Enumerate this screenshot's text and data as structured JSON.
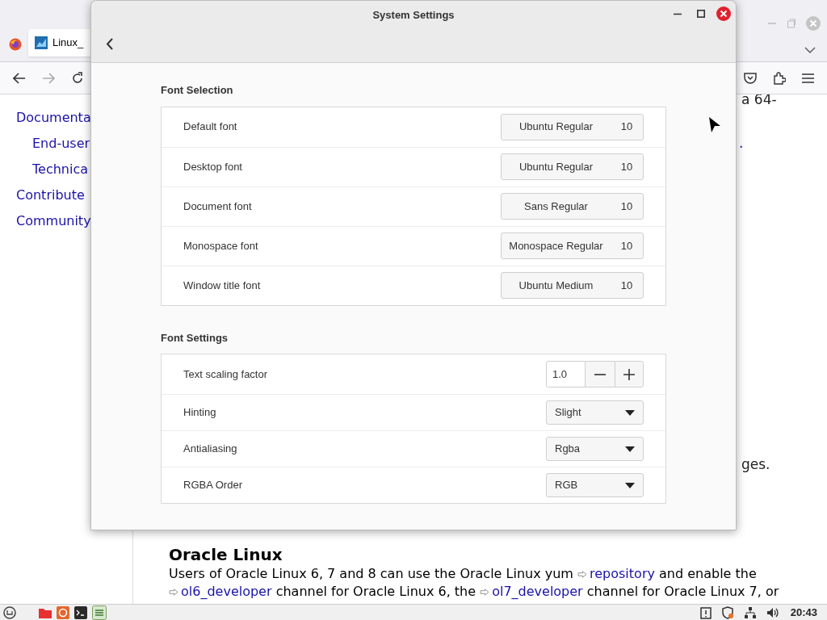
{
  "browser": {
    "tab": {
      "title": "Linux_"
    },
    "sidebar_links": [
      {
        "label": "Documenta",
        "children": [
          {
            "label": "End-user"
          },
          {
            "label": "Technica"
          }
        ]
      },
      {
        "label": "Contribute"
      },
      {
        "label": "Community"
      }
    ],
    "page_fragments": [
      {
        "text": "a 64-",
        "kind": "text"
      },
      {
        "text": ".",
        "kind": "link"
      },
      {
        "text": "ges.",
        "kind": "text"
      }
    ],
    "article": {
      "heading": "Oracle Linux",
      "paragraph": [
        {
          "kind": "text",
          "text": "Users of Oracle Linux 6, 7 and 8 can use the Oracle Linux yum "
        },
        {
          "kind": "link",
          "text": "repository"
        },
        {
          "kind": "text",
          "text": " and enable the "
        },
        {
          "kind": "link",
          "text": "ol6_developer"
        },
        {
          "kind": "text",
          "text": " channel for Oracle Linux 6, the "
        },
        {
          "kind": "link",
          "text": "ol7_developer"
        },
        {
          "kind": "text",
          "text": " channel for Oracle Linux 7, or"
        }
      ]
    }
  },
  "settings_window": {
    "title": "System Settings",
    "sections": [
      {
        "title": "Font Selection",
        "rows": [
          {
            "kind": "font",
            "label": "Default font",
            "font": "Ubuntu Regular",
            "size": "10"
          },
          {
            "kind": "font",
            "label": "Desktop font",
            "font": "Ubuntu Regular",
            "size": "10"
          },
          {
            "kind": "font",
            "label": "Document font",
            "font": "Sans Regular",
            "size": "10"
          },
          {
            "kind": "font",
            "label": "Monospace font",
            "font": "Monospace Regular",
            "size": "10"
          },
          {
            "kind": "font",
            "label": "Window title font",
            "font": "Ubuntu Medium",
            "size": "10"
          }
        ]
      },
      {
        "title": "Font Settings",
        "rows": [
          {
            "kind": "spin",
            "label": "Text scaling factor",
            "value": "1.0"
          },
          {
            "kind": "dropdown",
            "label": "Hinting",
            "value": "Slight"
          },
          {
            "kind": "dropdown",
            "label": "Antialiasing",
            "value": "Rgba"
          },
          {
            "kind": "dropdown",
            "label": "RGBA Order",
            "value": "RGB"
          }
        ]
      }
    ]
  },
  "taskbar": {
    "clock": "20:43"
  }
}
